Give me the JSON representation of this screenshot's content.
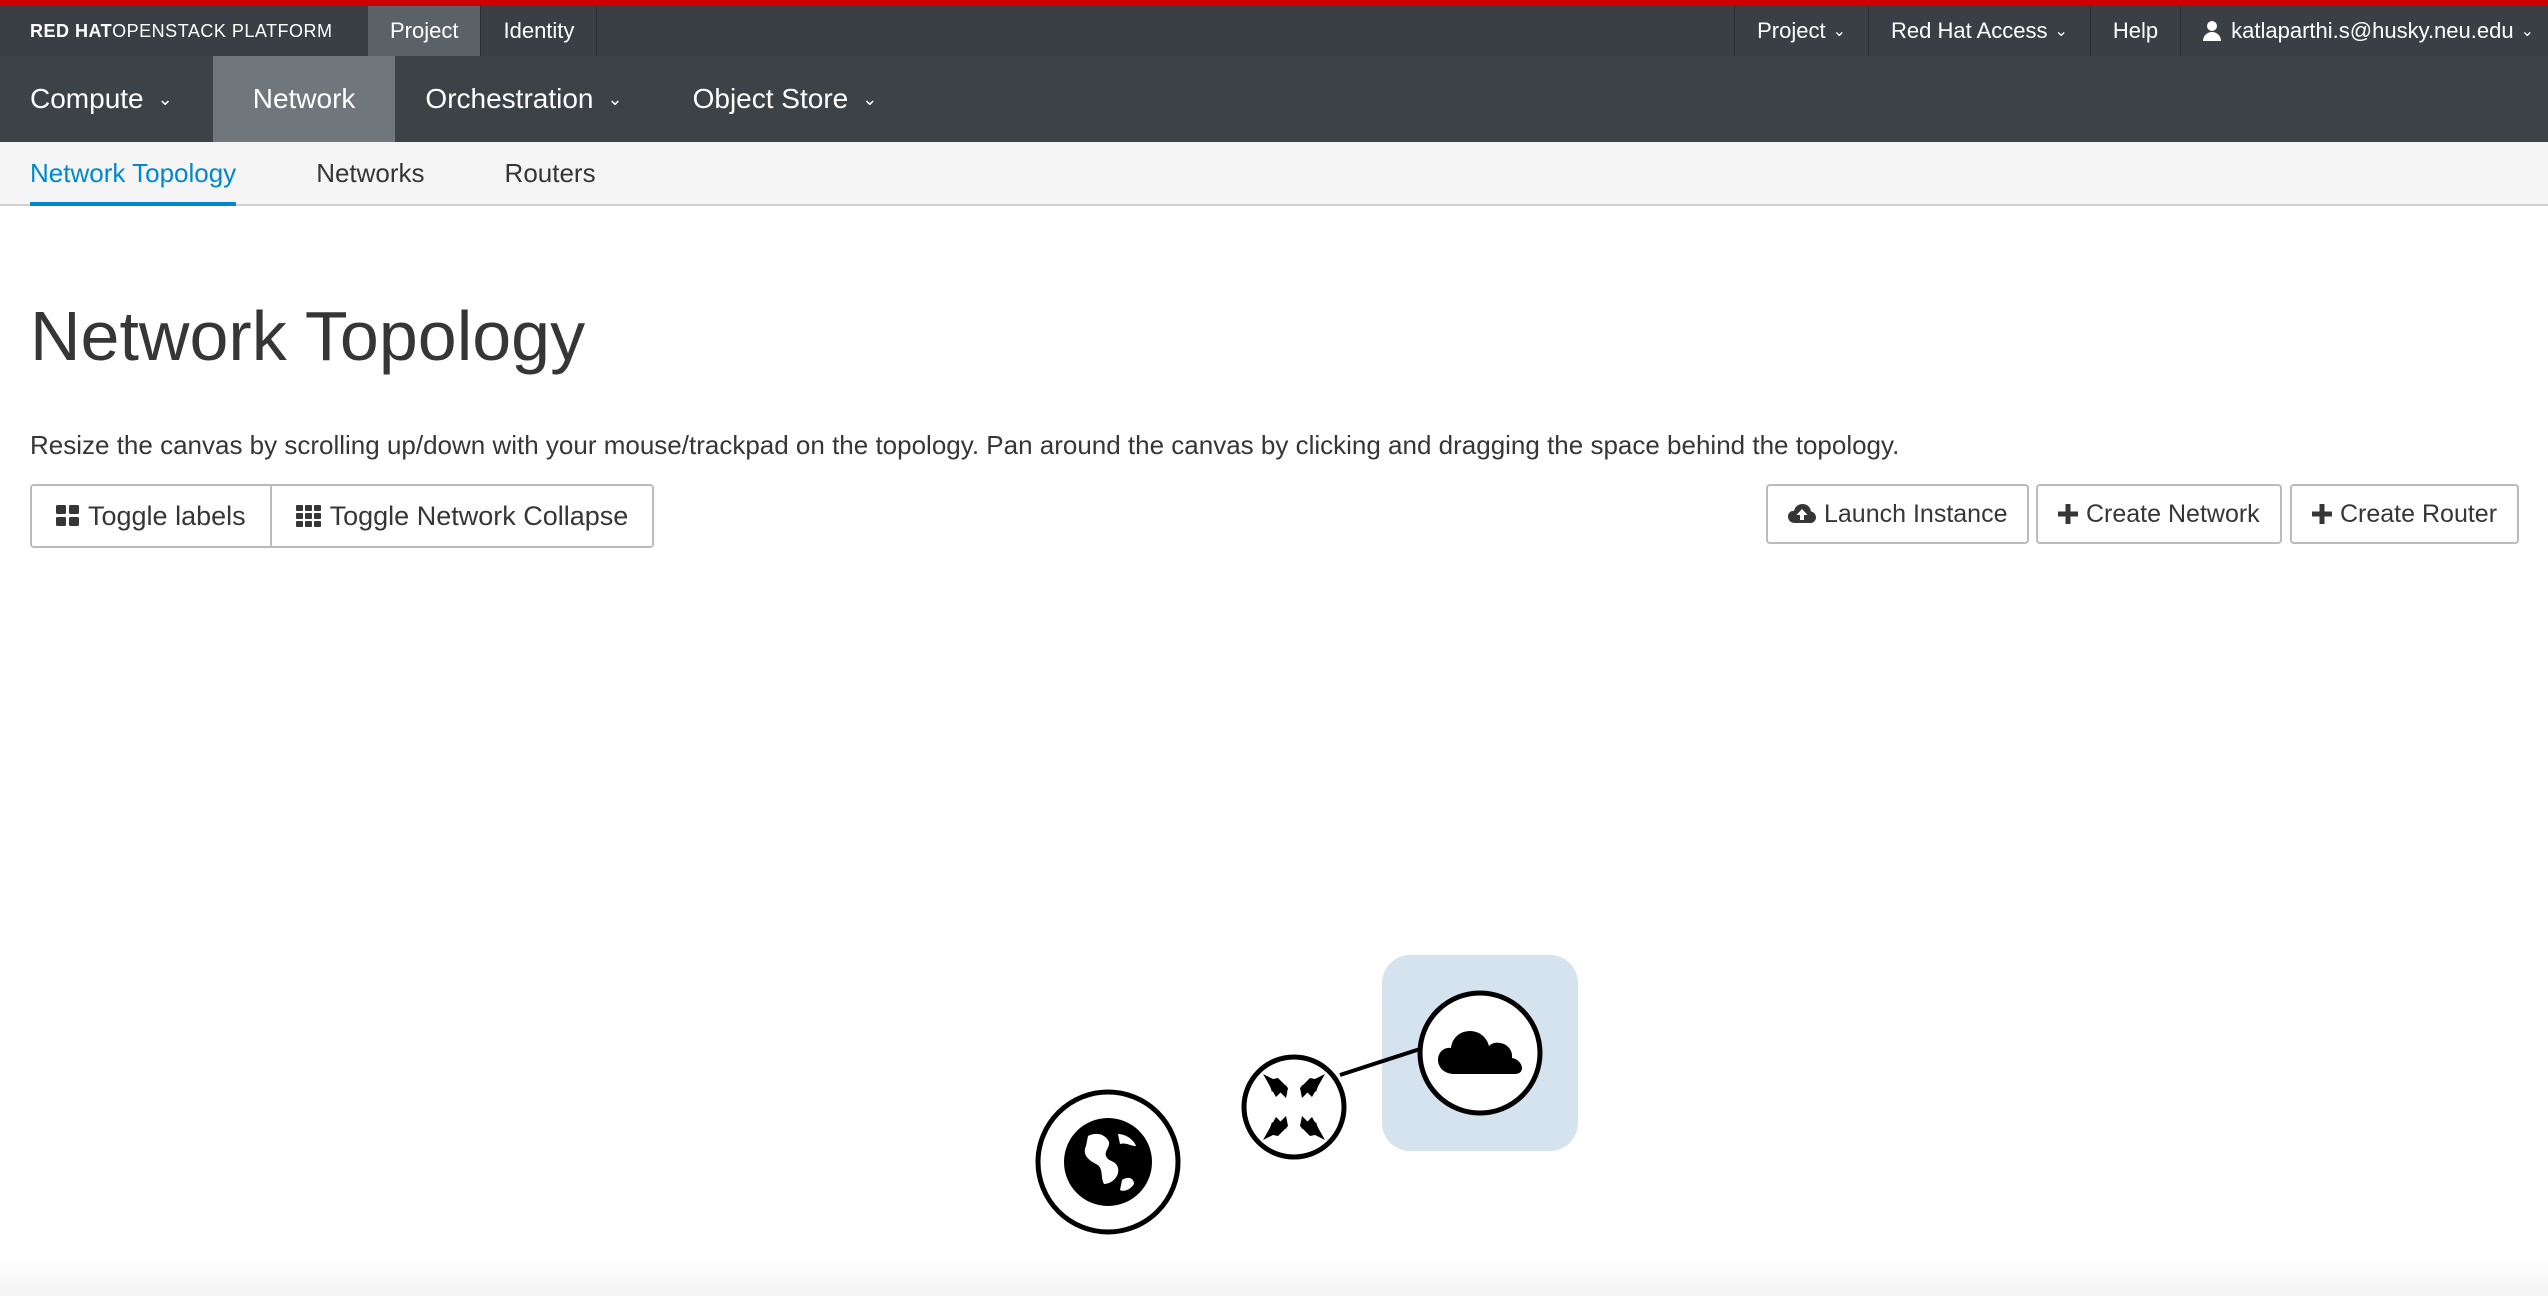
{
  "brand": {
    "bold": "RED HAT",
    "rest": " OPENSTACK PLATFORM"
  },
  "dashboards": [
    {
      "label": "Project",
      "active": true
    },
    {
      "label": "Identity",
      "active": false
    }
  ],
  "utility": {
    "project_label": "Project",
    "access_label": "Red Hat Access",
    "help_label": "Help",
    "user_label": "katlaparthi.s@husky.neu.edu"
  },
  "mainnav": [
    {
      "label": "Compute",
      "has_dropdown": true,
      "active": false
    },
    {
      "label": "Network",
      "has_dropdown": false,
      "active": true
    },
    {
      "label": "Orchestration",
      "has_dropdown": true,
      "active": false
    },
    {
      "label": "Object Store",
      "has_dropdown": true,
      "active": false
    }
  ],
  "subnav": [
    {
      "label": "Network Topology",
      "active": true
    },
    {
      "label": "Networks",
      "active": false
    },
    {
      "label": "Routers",
      "active": false
    }
  ],
  "page": {
    "title": "Network Topology",
    "help": "Resize the canvas by scrolling up/down with your mouse/trackpad on the topology. Pan around the canvas by clicking and dragging the space behind the topology."
  },
  "toolbar": {
    "toggle_labels": "Toggle labels",
    "toggle_collapse": "Toggle Network Collapse",
    "launch_instance": "Launch Instance",
    "create_network": "Create Network",
    "create_router": "Create Router"
  },
  "topology": {
    "nodes": [
      {
        "type": "external-network",
        "icon": "globe-icon"
      },
      {
        "type": "router",
        "icon": "router-arrows-icon"
      },
      {
        "type": "network",
        "icon": "cloud-icon",
        "highlighted": true
      }
    ]
  },
  "colors": {
    "brand_red": "#cc0000",
    "topbar": "#393f44",
    "nav": "#3d4247",
    "nav_active": "#6f767c",
    "link_active": "#0088ce",
    "highlight": "#d4e3ee"
  }
}
